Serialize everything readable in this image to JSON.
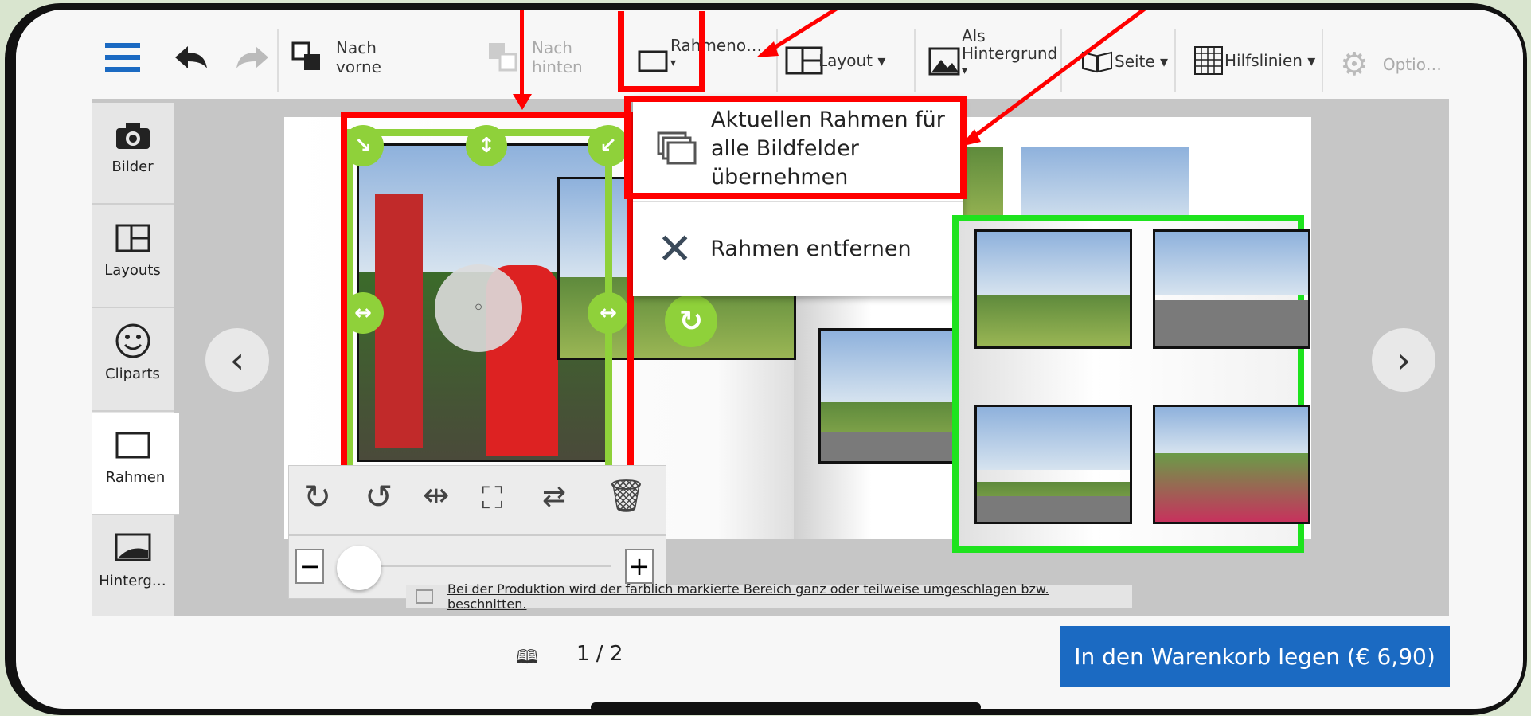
{
  "toolbar": {
    "to_front": [
      "Nach",
      "vorne"
    ],
    "to_back": [
      "Nach",
      "hinten"
    ],
    "frame_menu": "Rahmeno…",
    "frame_menu_caret": "▾",
    "layout": "Layout ▾",
    "as_background": [
      "Als",
      "Hintergrund",
      "▾"
    ],
    "page": "Seite ▾",
    "guides": "Hilfslinien ▾",
    "options": "Optio…"
  },
  "sidebar": {
    "items": [
      {
        "label": "Bilder",
        "icon": "camera-icon"
      },
      {
        "label": "Layouts",
        "icon": "layout-icon"
      },
      {
        "label": "Cliparts",
        "icon": "smiley-icon"
      },
      {
        "label": "Rahmen",
        "icon": "frame-icon"
      },
      {
        "label": "Hinterg…",
        "icon": "background-icon"
      }
    ]
  },
  "frame_menu": {
    "apply_all": [
      "Aktuellen Rahmen für",
      "alle Bildfelder",
      "übernehmen"
    ],
    "remove": "Rahmen entfernen"
  },
  "notice": "Bei der Produktion wird der farblich markierte Bereich ganz oder teilweise umgeschlagen bzw. beschnitten.",
  "pager": "1 / 2",
  "cart_button": "In den Warenkorb legen (€ 6,90)",
  "colors": {
    "accent": "#1b6ac2",
    "highlight_red": "#ff0000",
    "highlight_green": "#1ee31e",
    "handle_green": "#8fd13a"
  }
}
